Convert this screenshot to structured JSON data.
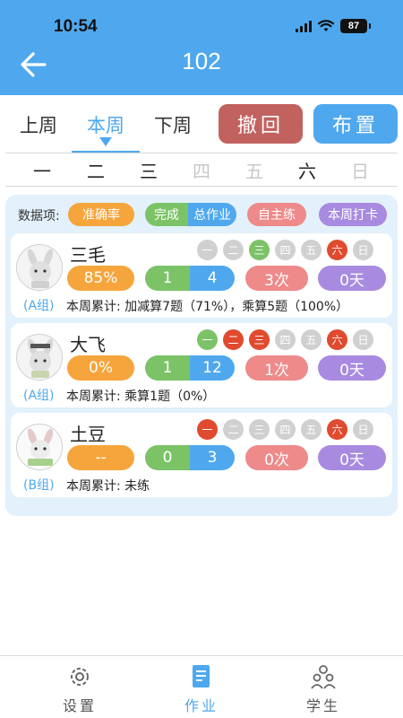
{
  "status_bar": {
    "time": "10:54",
    "battery": "87"
  },
  "header": {
    "title": "102"
  },
  "week_tabs": [
    {
      "label": "上周",
      "active": false
    },
    {
      "label": "本周",
      "active": true
    },
    {
      "label": "下周",
      "active": false
    }
  ],
  "buttons": {
    "undo": "撤回",
    "assign": "布置"
  },
  "days": [
    {
      "label": "一",
      "dim": false
    },
    {
      "label": "二",
      "dim": false
    },
    {
      "label": "三",
      "dim": false
    },
    {
      "label": "四",
      "dim": true
    },
    {
      "label": "五",
      "dim": true
    },
    {
      "label": "六",
      "dim": false
    },
    {
      "label": "日",
      "dim": true
    }
  ],
  "legend": {
    "label": "数据项:",
    "accuracy": "准确率",
    "done": "完成",
    "total": "总作业",
    "self_practice": "自主练",
    "checkin": "本周打卡"
  },
  "students": [
    {
      "name": "三毛",
      "group": "(A组)",
      "days": [
        {
          "label": "一",
          "state": "gray"
        },
        {
          "label": "二",
          "state": "gray"
        },
        {
          "label": "三",
          "state": "green"
        },
        {
          "label": "四",
          "state": "gray"
        },
        {
          "label": "五",
          "state": "gray"
        },
        {
          "label": "六",
          "state": "red"
        },
        {
          "label": "日",
          "state": "gray"
        }
      ],
      "accuracy": "85%",
      "done": "1",
      "total": "4",
      "self_practice": "3次",
      "checkin": "0天",
      "summary": "本周累计: 加减算7题（71%），乘算5题（100%）"
    },
    {
      "name": "大飞",
      "group": "(A组)",
      "days": [
        {
          "label": "一",
          "state": "green"
        },
        {
          "label": "二",
          "state": "red"
        },
        {
          "label": "三",
          "state": "red"
        },
        {
          "label": "四",
          "state": "gray"
        },
        {
          "label": "五",
          "state": "gray"
        },
        {
          "label": "六",
          "state": "red"
        },
        {
          "label": "日",
          "state": "gray"
        }
      ],
      "accuracy": "0%",
      "done": "1",
      "total": "12",
      "self_practice": "1次",
      "checkin": "0天",
      "summary": "本周累计: 乘算1题（0%）"
    },
    {
      "name": "土豆",
      "group": "(B组)",
      "days": [
        {
          "label": "一",
          "state": "red"
        },
        {
          "label": "二",
          "state": "gray"
        },
        {
          "label": "三",
          "state": "gray"
        },
        {
          "label": "四",
          "state": "gray"
        },
        {
          "label": "五",
          "state": "gray"
        },
        {
          "label": "六",
          "state": "red"
        },
        {
          "label": "日",
          "state": "gray"
        }
      ],
      "accuracy": "--",
      "done": "0",
      "total": "3",
      "self_practice": "0次",
      "checkin": "0天",
      "summary": "本周累计: 未练"
    }
  ],
  "tabbar": [
    {
      "label": "设置",
      "icon": "gear-icon",
      "active": false
    },
    {
      "label": "作业",
      "icon": "homework-icon",
      "active": true
    },
    {
      "label": "学生",
      "icon": "students-icon",
      "active": false
    }
  ],
  "colors": {
    "primary": "#4fa8ee",
    "undo": "#c2625e",
    "orange": "#f6a53c",
    "green": "#7cc368",
    "red_pill": "#ee8a8a",
    "purple": "#a88be0",
    "red_day": "#e04a2e"
  }
}
